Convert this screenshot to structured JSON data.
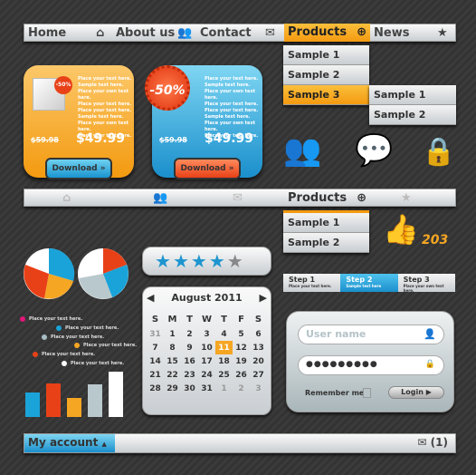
{
  "nav": {
    "home": "Home",
    "about": "About us",
    "contact": "Contact",
    "products": "Products",
    "news": "News"
  },
  "dropdown": [
    "Sample 1",
    "Sample 2",
    "Sample 3"
  ],
  "submenu": [
    "Sample 1",
    "Sample 2"
  ],
  "dropdown2": [
    "Sample 1",
    "Sample 2"
  ],
  "cards": [
    {
      "badge": "-50%",
      "lines": [
        "Place your text here.",
        "Sample text here.",
        "Place your own text here.",
        "Place your text here.",
        "Place your text here.",
        "Sample text here.",
        "Place your own text here.",
        "Place your text here."
      ],
      "old_price": "$59.98",
      "price": "$49.99",
      "button": "Download"
    },
    {
      "badge": "-50%",
      "lines": [
        "Place your text here.",
        "Sample text here.",
        "Place your own text here.",
        "Place your text here.",
        "Place your text here.",
        "Sample text here.",
        "Place your own text here.",
        "Place your text here."
      ],
      "old_price": "$59.98",
      "price": "$49.99",
      "button": "Download"
    }
  ],
  "likes": "203",
  "rating": {
    "value": 4,
    "max": 5
  },
  "calendar": {
    "title": "August 2011",
    "days": [
      "S",
      "M",
      "T",
      "W",
      "T",
      "F",
      "S"
    ],
    "weeks": [
      [
        "31",
        "1",
        "2",
        "3",
        "4",
        "5",
        "6"
      ],
      [
        "7",
        "8",
        "9",
        "10",
        "11",
        "12",
        "13"
      ],
      [
        "14",
        "15",
        "16",
        "17",
        "18",
        "19",
        "20"
      ],
      [
        "21",
        "22",
        "23",
        "24",
        "25",
        "26",
        "27"
      ],
      [
        "28",
        "29",
        "30",
        "31",
        "1",
        "2",
        "3"
      ]
    ],
    "selected": "11"
  },
  "steps": [
    {
      "title": "Step 1",
      "sub": "Place your text here."
    },
    {
      "title": "Step 2",
      "sub": "Sample text here"
    },
    {
      "title": "Step 3",
      "sub": "Place your own text here."
    }
  ],
  "login": {
    "username_placeholder": "User name",
    "password": "●●●●●●●●●",
    "remember": "Remember me",
    "button": "Login"
  },
  "legend": [
    {
      "label": "Place your text here.",
      "color": "#e0177a"
    },
    {
      "label": "Place your text here.",
      "color": "#1aa3d8"
    },
    {
      "label": "Place your text here.",
      "color": "#a9bcc3"
    },
    {
      "label": "Place your text here.",
      "color": "#f5a623"
    },
    {
      "label": "Place your text here.",
      "color": "#e84118"
    },
    {
      "label": "Place your text here.",
      "color": "#ffffff"
    }
  ],
  "bar_chart": {
    "values": [
      55,
      75,
      42,
      72,
      100
    ],
    "colors": [
      "#1aa3d8",
      "#e84118",
      "#f5a623",
      "#b9c8cc",
      "#ffffff"
    ]
  },
  "footer": {
    "account": "My account",
    "messages": "(1)"
  },
  "colors": {
    "accent": "#f39a10",
    "blue": "#1e95cf",
    "red": "#e84118"
  }
}
